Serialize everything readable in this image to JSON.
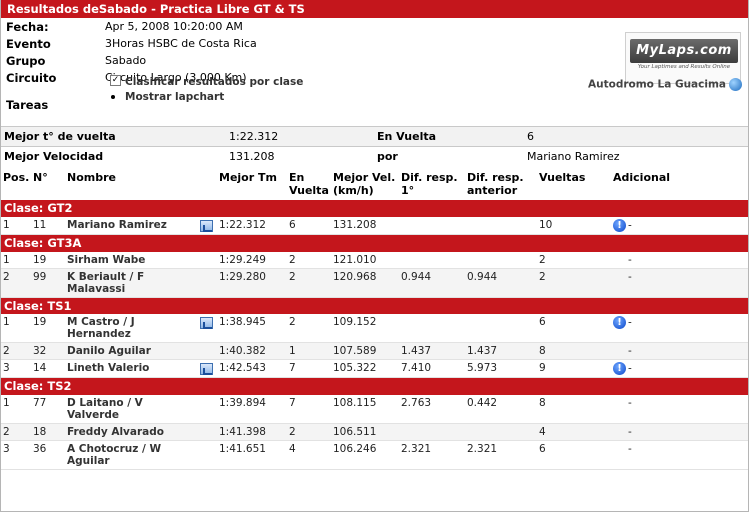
{
  "title": "Resultados deSabado - Practica Libre GT & TS",
  "info": {
    "fecha_label": "Fecha:",
    "fecha": "Apr 5, 2008 10:20:00 AM",
    "evento_label": "Evento",
    "evento": "3Horas HSBC de Costa Rica",
    "grupo_label": "Grupo",
    "grupo": "Sabado",
    "circuito_label": "Circuito",
    "circuito": "Circuito Largo (3.000 Km)",
    "tareas_label": "Tareas",
    "opt_clasificar": "Clasificar resultados por clase",
    "opt_lapchart": "Mostrar lapchart",
    "clasificar_checked": "✓",
    "track": "Autodromo La Guacima"
  },
  "logo": {
    "brand": "MyLaps.com",
    "tagline": "Your Laptimes and Results Online"
  },
  "summary": {
    "mejor_vuelta_label": "Mejor t° de vuelta",
    "mejor_vuelta": "1:22.312",
    "en_vuelta_label": "En Vuelta",
    "en_vuelta": "6",
    "mejor_vel_label": "Mejor Velocidad",
    "mejor_vel": "131.208",
    "por_label": "por",
    "por": "Mariano Ramirez"
  },
  "columns": {
    "pos": "Pos.",
    "num": "N°",
    "nombre": "Nombre",
    "mejor_tm": "Mejor Tm",
    "en_vuelta": "En Vuelta",
    "mejor_vel": "Mejor Vel. (km/h)",
    "dif1": "Dif. resp. 1°",
    "difant": "Dif. resp. anterior",
    "vueltas": "Vueltas",
    "adicional": "Adicional"
  },
  "classes": [
    {
      "name": "Clase: GT2",
      "rows": [
        {
          "pos": "1",
          "num": "11",
          "nombre": "Mariano Ramirez",
          "lapchart": true,
          "tm": "1:22.312",
          "vuelta": "6",
          "vel": "131.208",
          "dif1": "",
          "difant": "",
          "vueltas": "10",
          "info": true,
          "adicional": "-"
        }
      ]
    },
    {
      "name": "Clase: GT3A",
      "rows": [
        {
          "pos": "1",
          "num": "19",
          "nombre": "Sirham Wabe",
          "lapchart": false,
          "tm": "1:29.249",
          "vuelta": "2",
          "vel": "121.010",
          "dif1": "",
          "difant": "",
          "vueltas": "2",
          "info": false,
          "adicional": "-"
        },
        {
          "pos": "2",
          "num": "99",
          "nombre": "K Beriault / F Malavassi",
          "lapchart": false,
          "tm": "1:29.280",
          "vuelta": "2",
          "vel": "120.968",
          "dif1": "0.944",
          "difant": "0.944",
          "vueltas": "2",
          "info": false,
          "adicional": "-"
        }
      ]
    },
    {
      "name": "Clase: TS1",
      "rows": [
        {
          "pos": "1",
          "num": "19",
          "nombre": "M Castro / J Hernandez",
          "lapchart": true,
          "tm": "1:38.945",
          "vuelta": "2",
          "vel": "109.152",
          "dif1": "",
          "difant": "",
          "vueltas": "6",
          "info": true,
          "adicional": "-"
        },
        {
          "pos": "2",
          "num": "32",
          "nombre": "Danilo Aguilar",
          "lapchart": false,
          "tm": "1:40.382",
          "vuelta": "1",
          "vel": "107.589",
          "dif1": "1.437",
          "difant": "1.437",
          "vueltas": "8",
          "info": false,
          "adicional": "-"
        },
        {
          "pos": "3",
          "num": "14",
          "nombre": "Lineth Valerio",
          "lapchart": true,
          "tm": "1:42.543",
          "vuelta": "7",
          "vel": "105.322",
          "dif1": "7.410",
          "difant": "5.973",
          "vueltas": "9",
          "info": true,
          "adicional": "-"
        }
      ]
    },
    {
      "name": "Clase: TS2",
      "rows": [
        {
          "pos": "1",
          "num": "77",
          "nombre": "D Laitano / V Valverde",
          "lapchart": false,
          "tm": "1:39.894",
          "vuelta": "7",
          "vel": "108.115",
          "dif1": "2.763",
          "difant": "0.442",
          "vueltas": "8",
          "info": false,
          "adicional": "-"
        },
        {
          "pos": "2",
          "num": "18",
          "nombre": "Freddy Alvarado",
          "lapchart": false,
          "tm": "1:41.398",
          "vuelta": "2",
          "vel": "106.511",
          "dif1": "",
          "difant": "",
          "vueltas": "4",
          "info": false,
          "adicional": "-"
        },
        {
          "pos": "3",
          "num": "36",
          "nombre": "A Chotocruz / W Aguilar",
          "lapchart": false,
          "tm": "1:41.651",
          "vuelta": "4",
          "vel": "106.246",
          "dif1": "2.321",
          "difant": "2.321",
          "vueltas": "6",
          "info": false,
          "adicional": "-"
        }
      ]
    }
  ],
  "colors": {
    "header_red": "#c4161c",
    "info_blue": "#0a46c9"
  }
}
